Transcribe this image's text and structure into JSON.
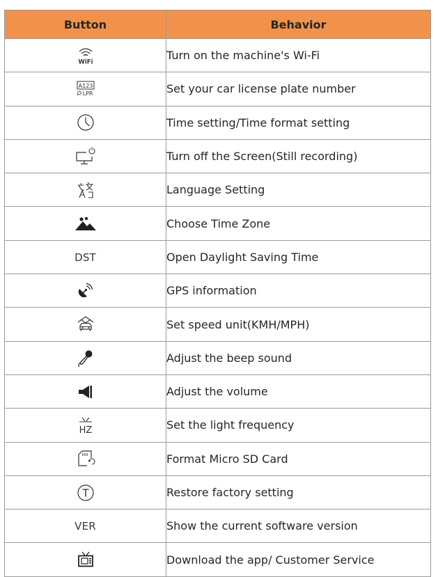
{
  "header": {
    "button": "Button",
    "behavior": "Behavior"
  },
  "rows": [
    {
      "icon": "wifi-icon",
      "icon_text": "WiFi",
      "behavior": "Turn on the machine's Wi-Fi"
    },
    {
      "icon": "license-plate-icon",
      "icon_text": "A123 LPR",
      "behavior": "Set your car license plate number"
    },
    {
      "icon": "clock-icon",
      "behavior": "Time setting/Time format setting"
    },
    {
      "icon": "monitor-power-icon",
      "behavior": "Turn off the Screen(Still recording)"
    },
    {
      "icon": "language-icon",
      "behavior": "Language Setting"
    },
    {
      "icon": "mountains-sun-icon",
      "behavior": "Choose Time Zone"
    },
    {
      "icon": "dst-text-icon",
      "icon_text": "DST",
      "behavior": "Open Daylight Saving Time"
    },
    {
      "icon": "gps-satellite-icon",
      "behavior": "GPS information"
    },
    {
      "icon": "speed-car-icon",
      "behavior": "Set speed unit(KMH/MPH)"
    },
    {
      "icon": "microphone-icon",
      "behavior": "Adjust the beep sound"
    },
    {
      "icon": "speaker-icon",
      "behavior": "Adjust the volume"
    },
    {
      "icon": "hz-tv-icon",
      "icon_text": "HZ",
      "behavior": "Set the light frequency"
    },
    {
      "icon": "sd-card-format-icon",
      "behavior": "Format Micro SD Card"
    },
    {
      "icon": "factory-reset-icon",
      "icon_text": "T",
      "behavior": "Restore factory setting"
    },
    {
      "icon": "ver-text-icon",
      "icon_text": "VER",
      "behavior": "Show the current software version"
    },
    {
      "icon": "tv-app-icon",
      "behavior": "Download the app/ Customer Service"
    }
  ],
  "colors": {
    "header_bg": "#f2924a",
    "border": "#9a9a9a",
    "text": "#262626"
  }
}
